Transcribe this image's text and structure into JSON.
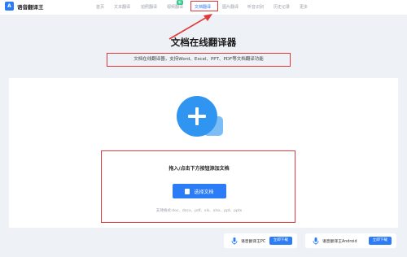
{
  "header": {
    "logo_mark": "A",
    "app_name": "语音翻译王",
    "nav": [
      "首页",
      "文本翻译",
      "拍照翻译",
      "视频翻译",
      "文档翻译",
      "图片翻译",
      "听音识别",
      "历史记录",
      "更多"
    ],
    "active_nav": "文档翻译",
    "badge": "新"
  },
  "main": {
    "title": "文档在线翻译器",
    "subtitle": "文档在线翻译器，支持Word、Excel、PPT、PDF等文档翻译功能",
    "upload_title": "拖入/点击下方按钮添加文档",
    "upload_button": "选择文档",
    "formats": "支持格式:doc、docx、pdf、xls、xlsx、ppt、pptx"
  },
  "downloads": [
    {
      "label": "语音翻译王PC",
      "button": "立即下载"
    },
    {
      "label": "语音翻译王Android",
      "button": "立即下载"
    }
  ],
  "colors": {
    "accent": "#2b7cf6",
    "highlight": "#e23a3a",
    "badge": "#35c98a",
    "background": "#eef1f5"
  },
  "icons": [
    "app-logo-icon",
    "arrow-annotation-icon",
    "document-add-icon",
    "file-icon",
    "mic-icon"
  ]
}
